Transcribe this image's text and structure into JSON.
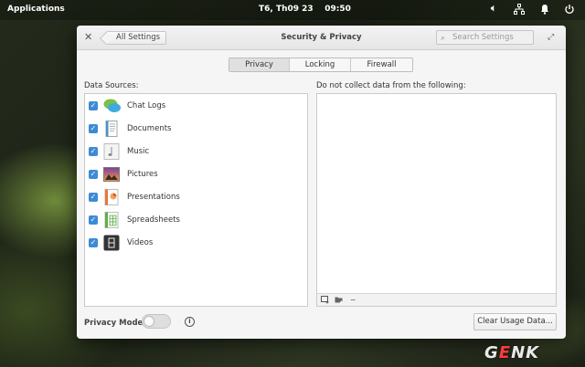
{
  "topbar": {
    "applications": "Applications",
    "clock": "T6, Th09 23    09:50"
  },
  "window": {
    "title": "Security & Privacy",
    "back_label": "All Settings",
    "search_placeholder": "Search Settings"
  },
  "tabs": [
    {
      "label": "Privacy",
      "active": true
    },
    {
      "label": "Locking",
      "active": false
    },
    {
      "label": "Firewall",
      "active": false
    }
  ],
  "data_sources": {
    "heading": "Data Sources:",
    "items": [
      {
        "label": "Chat Logs",
        "checked": true,
        "icon": "chat-logs-icon"
      },
      {
        "label": "Documents",
        "checked": true,
        "icon": "documents-icon"
      },
      {
        "label": "Music",
        "checked": true,
        "icon": "music-icon"
      },
      {
        "label": "Pictures",
        "checked": true,
        "icon": "pictures-icon"
      },
      {
        "label": "Presentations",
        "checked": true,
        "icon": "presentations-icon"
      },
      {
        "label": "Spreadsheets",
        "checked": true,
        "icon": "spreadsheets-icon"
      },
      {
        "label": "Videos",
        "checked": true,
        "icon": "videos-icon"
      }
    ]
  },
  "exclusions": {
    "heading": "Do not collect data from the following:",
    "items": []
  },
  "footer": {
    "privacy_mode_label": "Privacy Mode:",
    "privacy_mode_on": false,
    "clear_button": "Clear Usage Data..."
  },
  "watermark": "GENK",
  "colors": {
    "checkbox": "#3d8bd4",
    "accent_brand": "#ff3a3a"
  }
}
